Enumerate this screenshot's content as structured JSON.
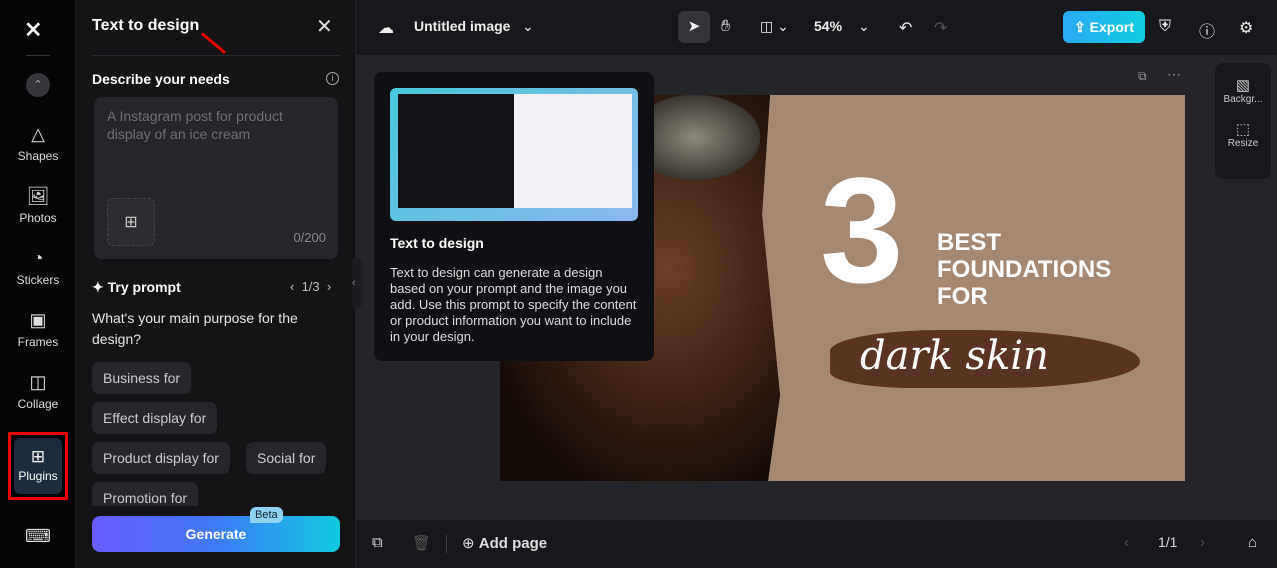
{
  "rail": {
    "items": [
      {
        "label": "Shapes",
        "icon": "shapes-icon"
      },
      {
        "label": "Photos",
        "icon": "photo-icon"
      },
      {
        "label": "Stickers",
        "icon": "sticker-icon"
      },
      {
        "label": "Frames",
        "icon": "frame-icon"
      },
      {
        "label": "Collage",
        "icon": "collage-icon"
      },
      {
        "label": "Plugins",
        "icon": "plugins-icon"
      }
    ]
  },
  "panel": {
    "title": "Text to design",
    "describe_label": "Describe your needs",
    "placeholder": "A Instagram post for product display of an ice cream",
    "counter": "0/200",
    "try_prompt": "Try prompt",
    "pager": "1/3",
    "question": "What's your main purpose for the design?",
    "chips": [
      "Business for",
      "Effect display for",
      "Product display for",
      "Social for",
      "Promotion for"
    ],
    "generate": "Generate",
    "beta": "Beta"
  },
  "topbar": {
    "title": "Untitled image",
    "zoom": "54%",
    "export": "Export",
    "accent": "#1fbcec"
  },
  "tooltip": {
    "title": "Text to design",
    "body": "Text to design can generate a design based on your prompt and the image you add. Use this prompt to specify the content or product information you want to include in your design."
  },
  "canvas": {
    "number": "3",
    "headline": "BEST FOUNDATIONS FOR",
    "script": "dark skin"
  },
  "right_panel": {
    "background": "Backgr...",
    "resize": "Resize"
  },
  "bottombar": {
    "add_page": "Add page",
    "page": "1/1"
  }
}
